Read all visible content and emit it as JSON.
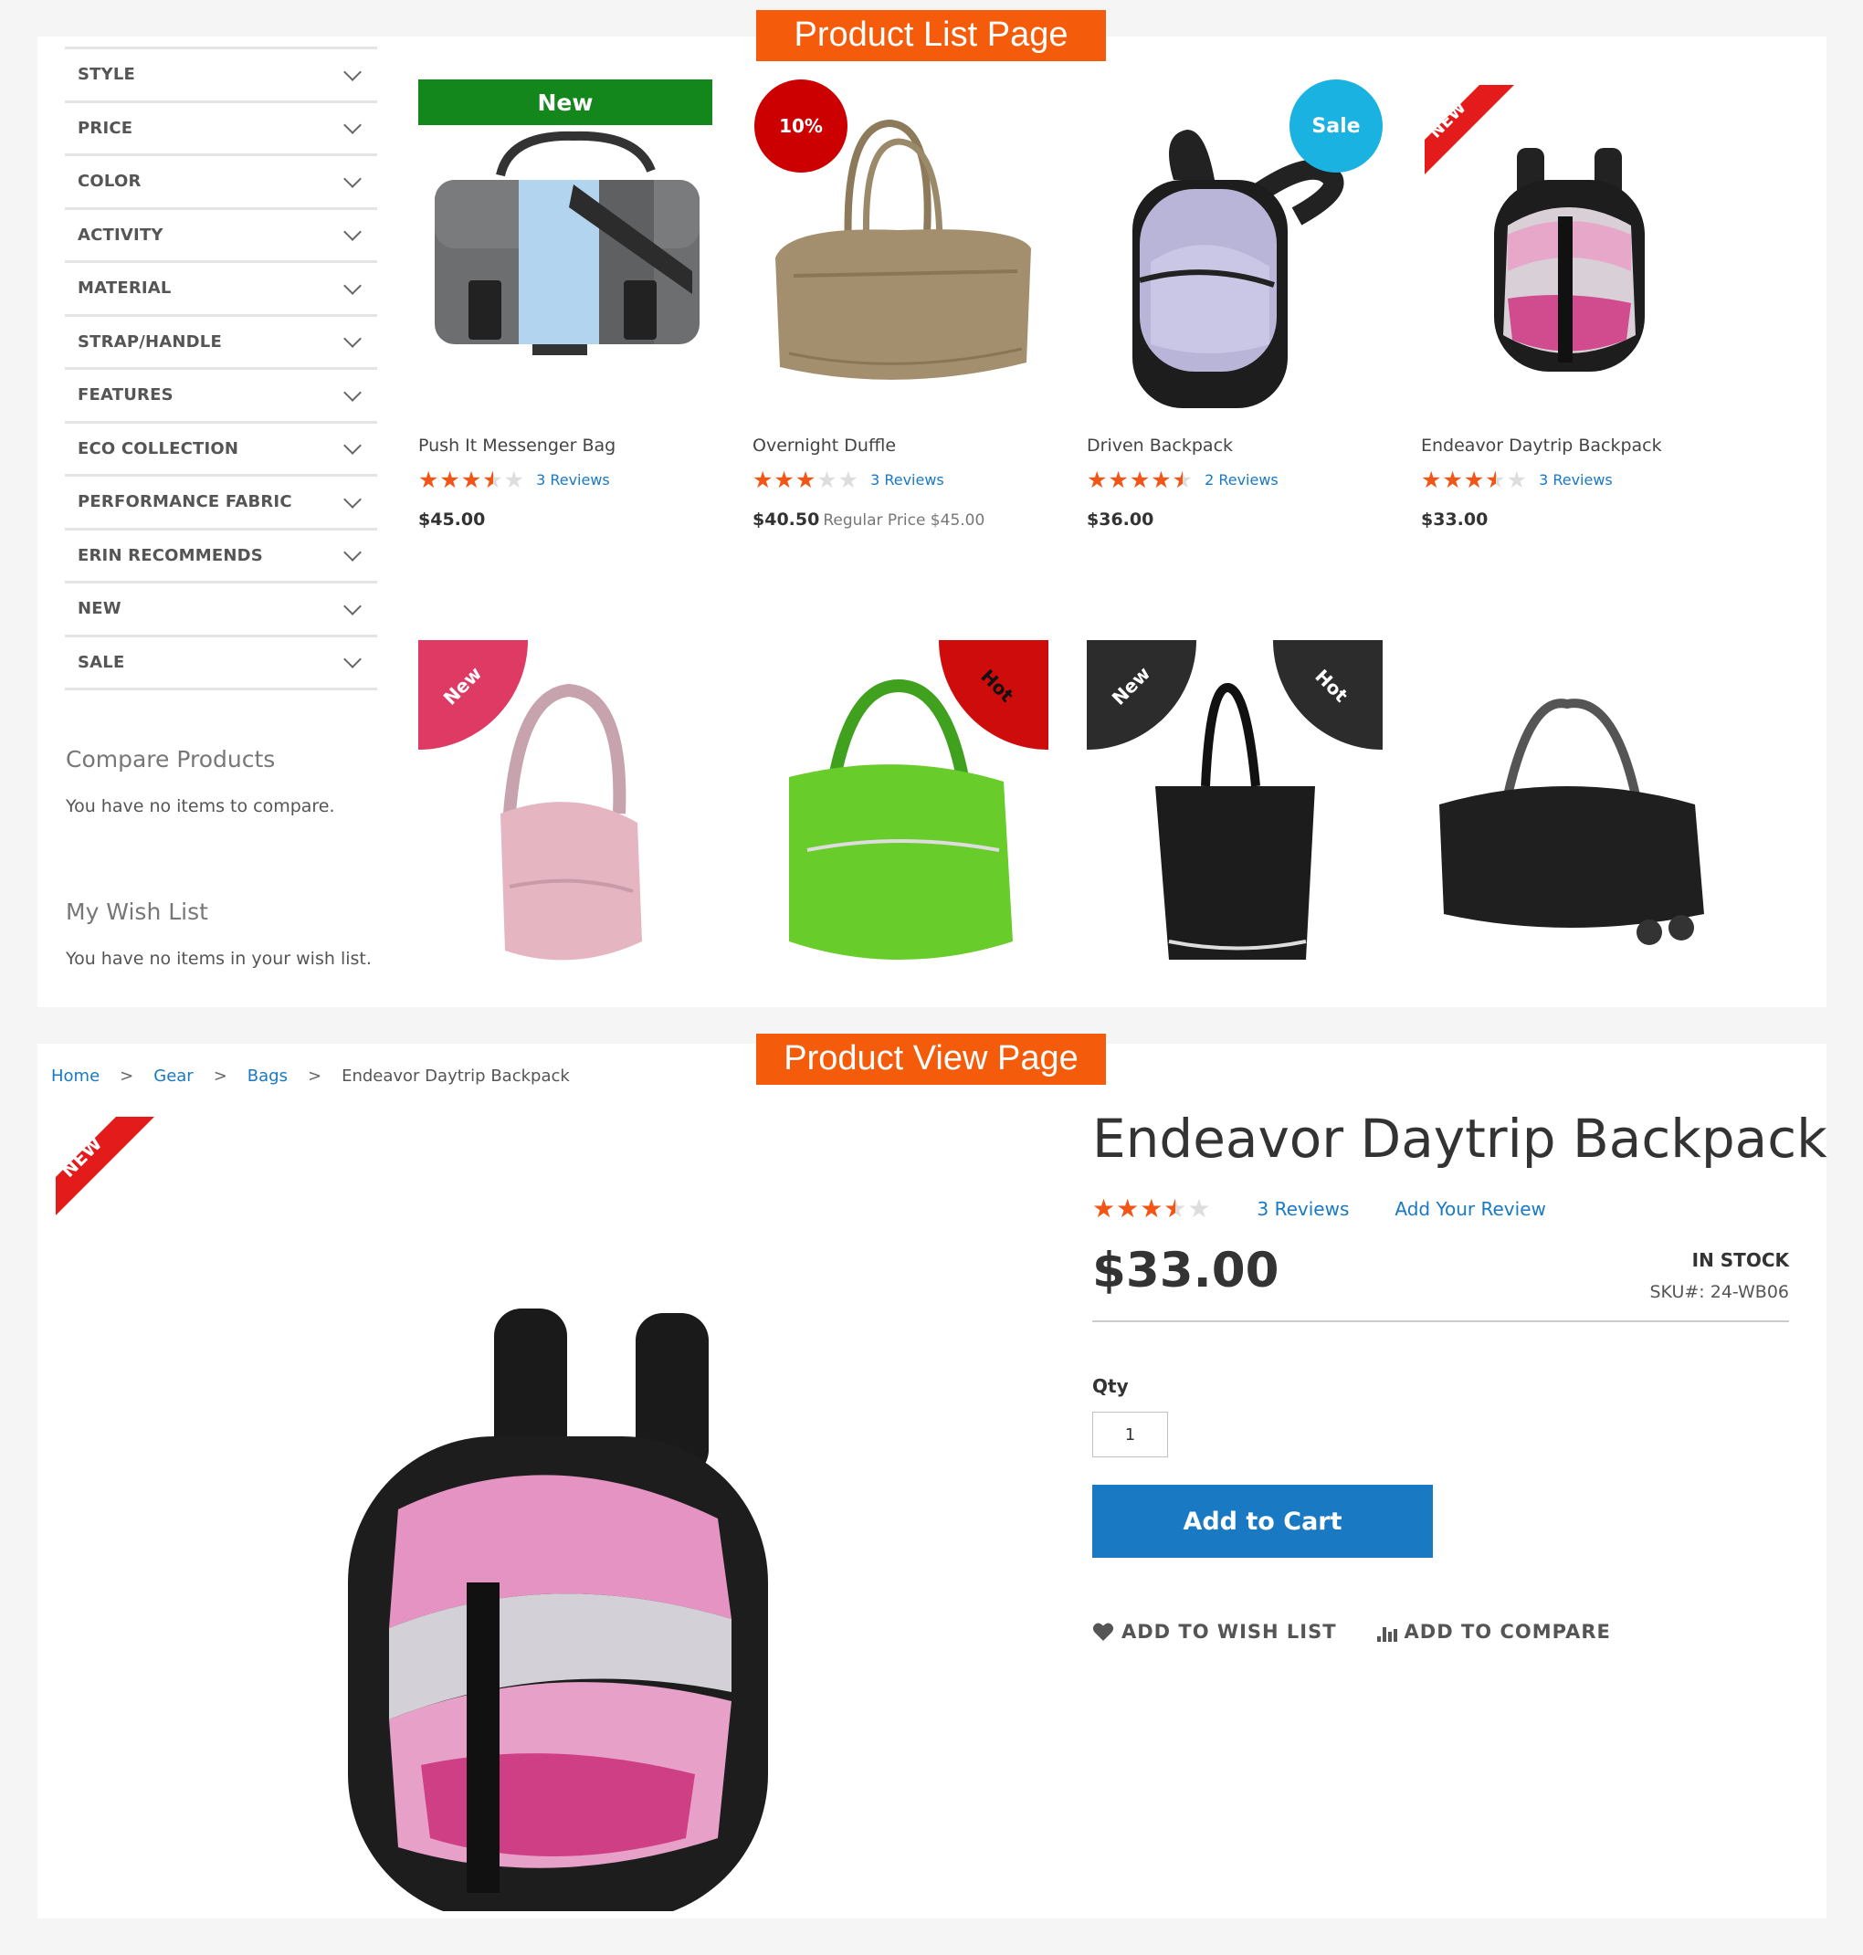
{
  "section_tags": {
    "list": "Product List Page",
    "view": "Product View Page"
  },
  "filters": [
    "STYLE",
    "PRICE",
    "COLOR",
    "ACTIVITY",
    "MATERIAL",
    "STRAP/HANDLE",
    "FEATURES",
    "ECO COLLECTION",
    "PERFORMANCE FABRIC",
    "ERIN RECOMMENDS",
    "NEW",
    "SALE"
  ],
  "compare": {
    "title": "Compare Products",
    "text": "You have no items to compare."
  },
  "wishlist": {
    "title": "My Wish List",
    "text": "You have no items in your wish list."
  },
  "products": [
    {
      "name": "Push It Messenger Bag",
      "rating": 0.7,
      "reviews": "3 Reviews",
      "price": "$45.00",
      "regular_price": "",
      "badge": "New",
      "badge_color": "#14871c"
    },
    {
      "name": "Overnight Duffle",
      "rating": 0.6,
      "reviews": "3 Reviews",
      "price": "$40.50",
      "regular_price": "Regular Price $45.00",
      "badge": "10%",
      "badge_color": "#cc0000"
    },
    {
      "name": "Driven Backpack",
      "rating": 0.9,
      "reviews": "2 Reviews",
      "price": "$36.00",
      "regular_price": "",
      "badge": "Sale",
      "badge_color": "#1ab2e0"
    },
    {
      "name": "Endeavor Daytrip Backpack",
      "rating": 0.7,
      "reviews": "3 Reviews",
      "price": "$33.00",
      "regular_price": "",
      "badge": "NEW",
      "badge_color": "#e31b1b"
    }
  ],
  "row2_badges": {
    "card5": "New",
    "card6": "Hot",
    "card7_a": "New",
    "card7_b": "Hot"
  },
  "breadcrumb": {
    "home": "Home",
    "gear": "Gear",
    "bags": "Bags",
    "current": "Endeavor Daytrip Backpack",
    "separator": ">"
  },
  "product_view": {
    "badge": "NEW",
    "title": "Endeavor Daytrip Backpack",
    "rating": 0.7,
    "reviews": "3  Reviews",
    "add_review": "Add Your Review",
    "price": "$33.00",
    "stock": "IN STOCK",
    "sku": "SKU#:  24-WB06",
    "qty_label": "Qty",
    "qty": "1",
    "add_to_cart": "Add to Cart",
    "add_to_wishlist": "ADD TO WISH LIST",
    "add_to_compare": "ADD TO COMPARE"
  },
  "stars_glyphs": "★★★★★",
  "colors": {
    "accent": "#1979c3",
    "tag": "#f45b0b",
    "star": "#f35516"
  }
}
